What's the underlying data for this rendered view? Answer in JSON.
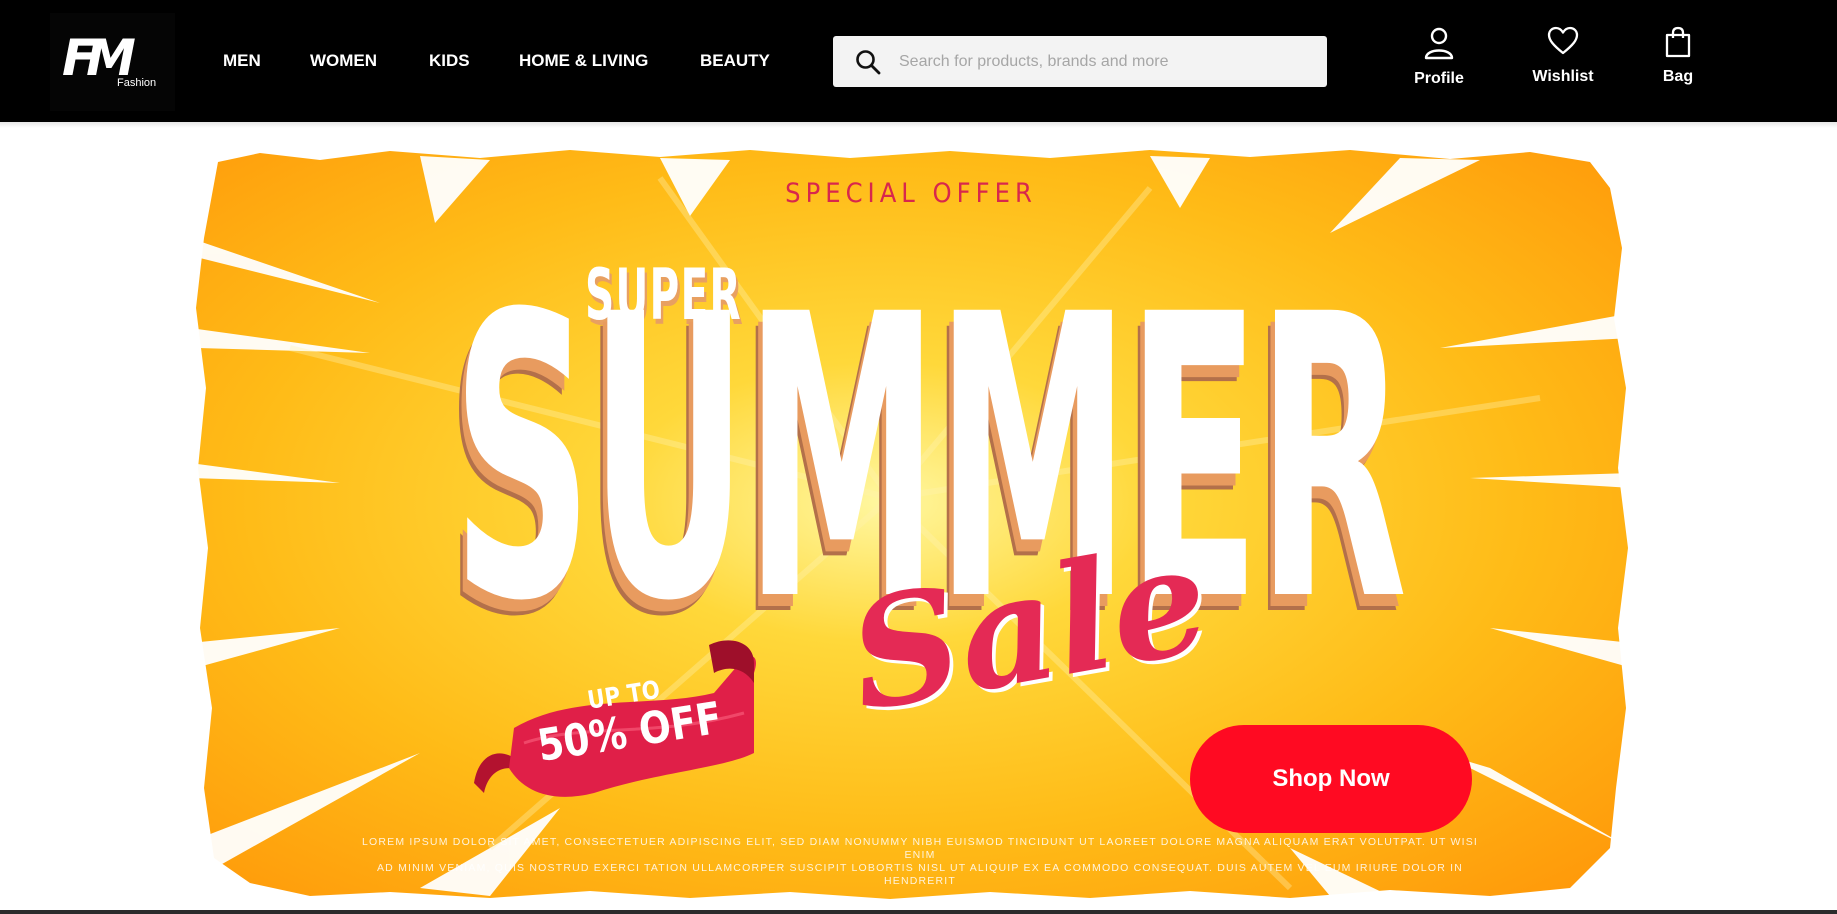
{
  "header": {
    "logo_mark": "FM",
    "logo_sub": "Fashion",
    "nav": [
      "MEN",
      "WOMEN",
      "KIDS",
      "HOME & LIVING",
      "BEAUTY"
    ],
    "search_placeholder": "Search for products, brands and more",
    "actions": {
      "profile": "Profile",
      "wishlist": "Wishlist",
      "bag": "Bag"
    }
  },
  "banner": {
    "special_offer": "SPECIAL OFFER",
    "super": "SUPER",
    "summer": "SUMMER",
    "sale": "Sale",
    "ribbon_line1": "UP TO",
    "ribbon_line2": "50% OFF",
    "cta": "Shop Now",
    "lorem_line1": "LOREM IPSUM DOLOR SIT AMET, CONSECTETUER ADIPISCING ELIT, SED DIAM NONUMMY NIBH EUISMOD TINCIDUNT UT LAOREET DOLORE MAGNA ALIQUAM ERAT VOLUTPAT. UT WISI ENIM",
    "lorem_line2": "AD MINIM VENIAM, QUIS NOSTRUD EXERCI TATION ULLAMCORPER SUSCIPIT LOBORTIS NISL UT ALIQUIP EX EA COMMODO CONSEQUAT. DUIS AUTEM VEL EUM IRIURE DOLOR IN HENDRERIT"
  },
  "colors": {
    "header_bg": "#000000",
    "accent_red": "#ff0a22",
    "sale_pink": "#e42a55",
    "banner_yellow": "#ffc21a",
    "banner_orange": "#ff9a0a"
  }
}
